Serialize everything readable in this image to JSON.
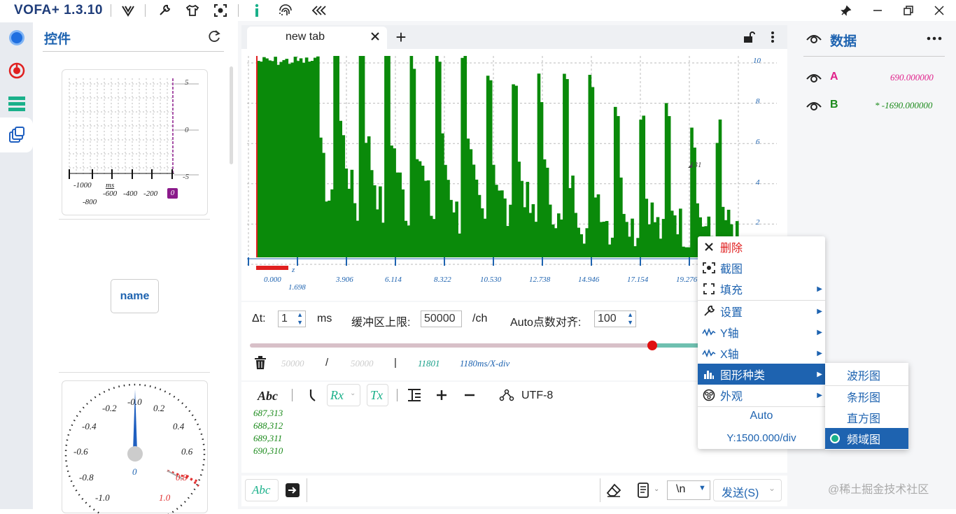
{
  "app": {
    "title": "VOFA+ 1.3.10"
  },
  "controls": {
    "title": "控件",
    "widget1": {
      "y_ticks": [
        "5",
        "0",
        "-5"
      ],
      "x_ticks": [
        "-1000",
        "-800",
        "ms",
        "-600",
        "-400",
        "-200"
      ],
      "value": "0"
    },
    "name_button": "name",
    "gauge": {
      "labels": [
        "-0.0",
        "0.2",
        "-0.2",
        "0.4",
        "-0.4",
        "0.6",
        "-0.6",
        "-0.8",
        "0.8",
        "-1.0",
        "1.0"
      ],
      "value": "0"
    }
  },
  "tab": {
    "label": "new tab",
    "add": "+"
  },
  "chart": {
    "y_ticks": [
      "10",
      "8",
      "6",
      "4",
      "2"
    ],
    "x_ticks": [
      "0.000",
      "1.698",
      "3.906",
      "6.114",
      "8.322",
      "10.530",
      "12.738",
      "14.946",
      "17.154",
      "19.276"
    ],
    "x_unit": "z",
    "marker": "131",
    "bar_color": "#0a8a0a",
    "grid": true
  },
  "settings": {
    "dt_label": "Δt:",
    "dt_value": "1",
    "dt_unit": "ms",
    "buffer_label": "缓冲区上限:",
    "buffer_value": "50000",
    "buffer_unit": "/ch",
    "auto_label": "Auto点数对齐:",
    "auto_value": "100",
    "stat1": "50000",
    "slash": "/",
    "stat2": "50000",
    "bar": "|",
    "stat3": "11801",
    "stat4": "1180ms/X-div",
    "slider_fraction": 0.86
  },
  "terminal": {
    "abc": "Abc",
    "rx": "Rx",
    "tx": "Tx",
    "encoding": "UTF-8",
    "lines": [
      "687,313",
      "688,312",
      "689,311",
      "690,310"
    ]
  },
  "sendbar": {
    "abc": "Abc",
    "newline": "\\n",
    "send": "发送(S)"
  },
  "data_panel": {
    "title": "数据",
    "channels": [
      {
        "name": "A",
        "value": "690.000000",
        "color": "#e0208a"
      },
      {
        "name": "B",
        "value": "* -1690.000000",
        "color": "#1a8a1a"
      }
    ]
  },
  "context_menu": {
    "items": [
      "删除",
      "截图",
      "填充",
      "设置",
      "Y轴",
      "X轴",
      "图形种类",
      "外观"
    ],
    "auto": "Auto",
    "y_div": "Y:1500.000/div",
    "submenu": [
      "波形图",
      "条形图",
      "直方图",
      "频域图"
    ]
  },
  "watermark": "@稀土掘金技术社区"
}
